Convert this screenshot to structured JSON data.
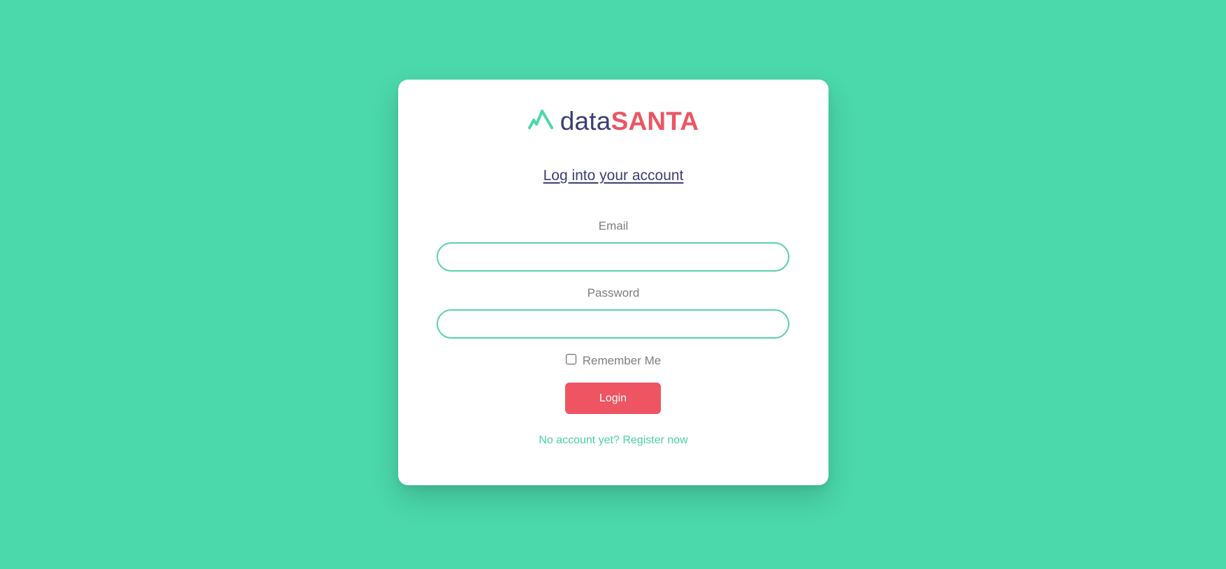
{
  "colors": {
    "background": "#4bd8ab",
    "card": "#ffffff",
    "brand_dark": "#3d3d73",
    "brand_red": "#ec5563",
    "accent_green": "#58d2ac"
  },
  "logo": {
    "icon": "mountain-peaks-icon",
    "word_part1": "data",
    "word_part2": "SANTA"
  },
  "login_form": {
    "heading": "Log into your account",
    "email_label": "Email",
    "email_value": "",
    "password_label": "Password",
    "password_value": "",
    "remember_label": "Remember Me",
    "remember_checked": false,
    "login_button_label": "Login",
    "register_link_text": "No account yet? Register now"
  }
}
